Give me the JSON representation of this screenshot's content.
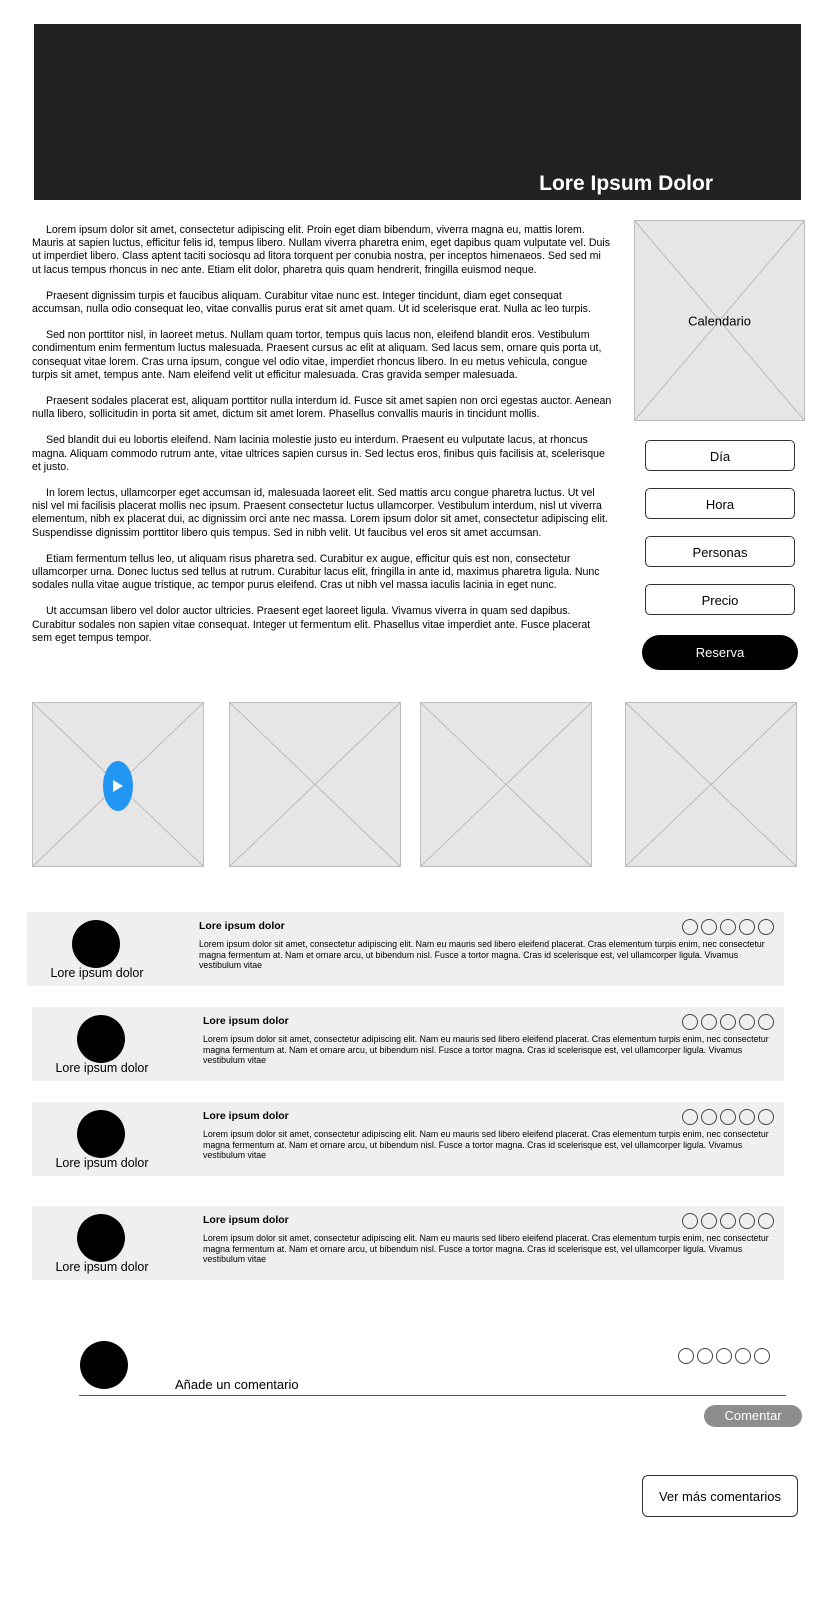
{
  "hero": {
    "title": "Lore Ipsum Dolor"
  },
  "article": {
    "paragraphs": [
      "Lorem ipsum dolor sit amet, consectetur adipiscing elit. Proin eget diam bibendum, viverra magna eu, mattis lorem. Mauris at sapien luctus, efficitur felis id, tempus libero. Nullam viverra pharetra enim, eget dapibus quam vulputate vel. Duis ut imperdiet libero. Class aptent taciti sociosqu ad litora torquent per conubia nostra, per inceptos himenaeos. Sed sed mi ut lacus tempus rhoncus in nec ante. Etiam elit dolor, pharetra quis quam hendrerit, fringilla euismod neque.",
      "Praesent dignissim turpis et faucibus aliquam. Curabitur vitae nunc est. Integer tincidunt, diam eget consequat accumsan, nulla odio consequat leo, vitae convallis purus erat sit amet quam. Ut id scelerisque erat. Nulla ac leo turpis.",
      "Sed non porttitor nisl, in laoreet metus. Nullam quam tortor, tempus quis lacus non, eleifend blandit eros. Vestibulum condimentum enim fermentum luctus malesuada. Praesent cursus ac elit at aliquam. Sed lacus sem, ornare quis porta ut, consequat vitae lorem. Cras urna ipsum, congue vel odio vitae, imperdiet rhoncus libero. In eu metus vehicula, congue turpis sit amet, tempus ante. Nam eleifend velit ut efficitur malesuada. Cras gravida semper malesuada.",
      "Praesent sodales placerat est, aliquam porttitor nulla interdum id. Fusce sit amet sapien non orci egestas auctor. Aenean nulla libero, sollicitudin in porta sit amet, dictum sit amet lorem. Phasellus convallis mauris in tincidunt mollis.",
      "Sed blandit dui eu lobortis eleifend. Nam lacinia molestie justo eu interdum. Praesent eu vulputate lacus, at rhoncus magna. Aliquam commodo rutrum ante, vitae ultrices sapien cursus in. Sed lectus eros, finibus quis facilisis at, scelerisque et justo.",
      "In lorem lectus, ullamcorper eget accumsan id, malesuada laoreet elit. Sed mattis arcu congue pharetra luctus. Ut vel nisl vel mi facilisis placerat mollis nec ipsum. Praesent consectetur luctus ullamcorper. Vestibulum interdum, nisl ut viverra elementum, nibh ex placerat dui, ac dignissim orci ante nec massa. Lorem ipsum dolor sit amet, consectetur adipiscing elit. Suspendisse dignissim porttitor libero quis tempus. Sed in nibh velit. Ut faucibus vel eros sit amet accumsan.",
      "Etiam fermentum tellus leo, ut aliquam risus pharetra sed. Curabitur ex augue, efficitur quis est non, consectetur ullamcorper urna. Donec luctus sed tellus at rutrum. Curabitur lacus elit, fringilla in ante id, maximus pharetra ligula. Nunc sodales nulla vitae augue tristique, ac tempor purus eleifend. Cras ut nibh vel massa iaculis lacinia in eget nunc.",
      "Ut accumsan libero vel dolor auctor ultricies. Praesent eget laoreet ligula. Vivamus viverra in quam sed dapibus. Curabitur sodales non sapien vitae consequat. Integer ut fermentum elit. Phasellus vitae imperdiet ante. Fusce placerat sem eget tempus tempor."
    ]
  },
  "booking": {
    "calendar_label": "Calendario",
    "fields": [
      "Día",
      "Hora",
      "Personas",
      "Precio"
    ],
    "reserve_label": "Reserva"
  },
  "gallery": {
    "play_color": "#2196f3"
  },
  "reviews": [
    {
      "name": "Lore ipsum dolor",
      "title": "Lore ipsum dolor",
      "text": "Lorem ipsum dolor sit amet, consectetur adipiscing elit. Nam eu mauris sed libero eleifend placerat. Cras elementum turpis enim, nec consectetur magna fermentum at. Nam et ornare arcu, ut bibendum nisl. Fusce a tortor magna. Cras id scelerisque est, vel ullamcorper ligula. Vivamus vestibulum vitae"
    },
    {
      "name": "Lore ipsum dolor",
      "title": "Lore ipsum dolor",
      "text": "Lorem ipsum dolor sit amet, consectetur adipiscing elit. Nam eu mauris sed libero eleifend placerat. Cras elementum turpis enim, nec consectetur magna fermentum at. Nam et ornare arcu, ut bibendum nisl. Fusce a tortor magna. Cras id scelerisque est, vel ullamcorper ligula. Vivamus vestibulum vitae"
    },
    {
      "name": "Lore ipsum dolor",
      "title": "Lore ipsum dolor",
      "text": "Lorem ipsum dolor sit amet, consectetur adipiscing elit. Nam eu mauris sed libero eleifend placerat. Cras elementum turpis enim, nec consectetur magna fermentum at. Nam et ornare arcu, ut bibendum nisl. Fusce a tortor magna. Cras id scelerisque est, vel ullamcorper ligula. Vivamus vestibulum vitae"
    },
    {
      "name": "Lore ipsum dolor",
      "title": "Lore ipsum dolor",
      "text": "Lorem ipsum dolor sit amet, consectetur adipiscing elit. Nam eu mauris sed libero eleifend placerat. Cras elementum turpis enim, nec consectetur magna fermentum at. Nam et ornare arcu, ut bibendum nisl. Fusce a tortor magna. Cras id scelerisque est, vel ullamcorper ligula. Vivamus vestibulum vitae"
    }
  ],
  "comment": {
    "placeholder": "Añade un comentario",
    "submit_label": "Comentar",
    "more_label": "Ver más comentarios"
  }
}
